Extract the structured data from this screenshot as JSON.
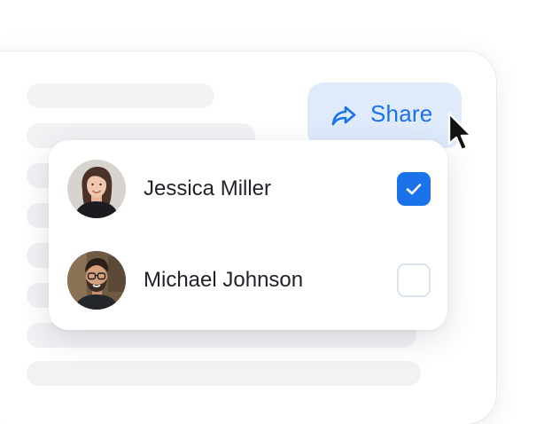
{
  "share": {
    "label": "Share",
    "icon": "share-arrow-icon"
  },
  "people": [
    {
      "name": "Jessica Miller",
      "avatar": "avatar-woman-photo",
      "selected": true
    },
    {
      "name": "Michael Johnson",
      "avatar": "avatar-man-photo",
      "selected": false
    }
  ],
  "colors": {
    "accent": "#1a73e8",
    "share_bg": "#dfeafb",
    "skeleton": "#f1f2f4",
    "checkbox_border": "#dbe3ef",
    "text": "#1f2328"
  }
}
